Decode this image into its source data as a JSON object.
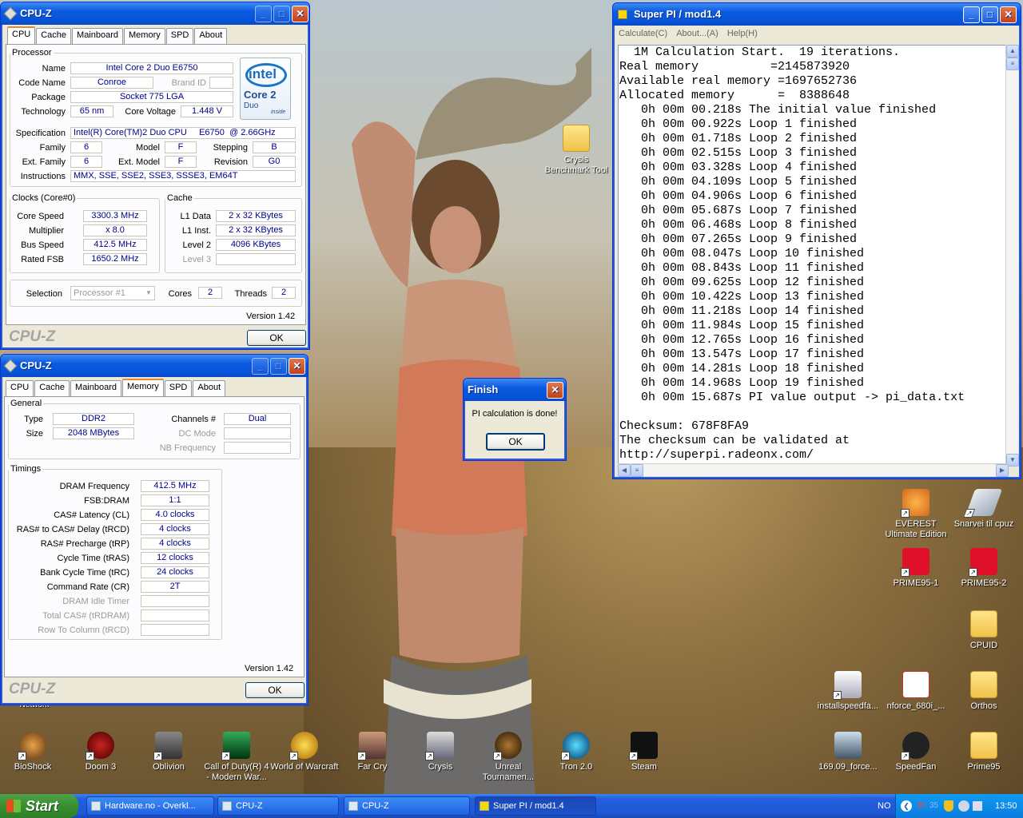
{
  "desktop": {
    "icons_right": [
      {
        "label": "Crysis Benchmark Tool"
      },
      {
        "label": "EVEREST Ultimate Edition"
      },
      {
        "label": "Snarvei til cpuz"
      },
      {
        "label": "PRIME95-1"
      },
      {
        "label": "PRIME95-2"
      },
      {
        "label": "CPUID"
      },
      {
        "label": "installspeedfa..."
      },
      {
        "label": "nforce_680i_..."
      },
      {
        "label": "Orthos"
      },
      {
        "label": "169.09_force..."
      },
      {
        "label": "SpeedFan"
      },
      {
        "label": "Prime95"
      }
    ],
    "icons_bottom": [
      "BioShock",
      "Doom 3",
      "Oblivion",
      "Call of Duty(R) 4 - Modern War...",
      "World of Warcraft",
      "Far Cry",
      "Crysis",
      "Unreal Tournamen...",
      "Tron 2.0",
      "Steam"
    ],
    "partial_label": "Network"
  },
  "cpuz1": {
    "title": "CPU-Z",
    "tabs": [
      "CPU",
      "Cache",
      "Mainboard",
      "Memory",
      "SPD",
      "About"
    ],
    "active": "CPU",
    "processor_legend": "Processor",
    "name_lbl": "Name",
    "name": "Intel Core 2 Duo E6750",
    "codename_lbl": "Code Name",
    "codename": "Conroe",
    "brandid_lbl": "Brand ID",
    "package_lbl": "Package",
    "package": "Socket 775 LGA",
    "tech_lbl": "Technology",
    "tech": "65 nm",
    "voltage_lbl": "Core Voltage",
    "voltage": "1.448 V",
    "spec_lbl": "Specification",
    "spec": "Intel(R) Core(TM)2 Duo CPU     E6750  @ 2.66GHz",
    "family_lbl": "Family",
    "family": "6",
    "model_lbl": "Model",
    "model": "F",
    "stepping_lbl": "Stepping",
    "stepping": "B",
    "extfamily_lbl": "Ext. Family",
    "extfamily": "6",
    "extmodel_lbl": "Ext. Model",
    "extmodel": "F",
    "revision_lbl": "Revision",
    "revision": "G0",
    "instr_lbl": "Instructions",
    "instr": "MMX, SSE, SSE2, SSE3, SSSE3, EM64T",
    "logo": {
      "brand": "intel",
      "line1": "Core 2",
      "line2": "Duo",
      "tag": "inside"
    },
    "clocks_legend": "Clocks (Core#0)",
    "corespeed_lbl": "Core Speed",
    "corespeed": "3300.3 MHz",
    "mult_lbl": "Multiplier",
    "mult": "x 8.0",
    "bus_lbl": "Bus Speed",
    "bus": "412.5 MHz",
    "fsb_lbl": "Rated FSB",
    "fsb": "1650.2 MHz",
    "cache_legend": "Cache",
    "l1d_lbl": "L1 Data",
    "l1d": "2 x 32 KBytes",
    "l1i_lbl": "L1 Inst.",
    "l1i": "2 x 32 KBytes",
    "l2_lbl": "Level 2",
    "l2": "4096 KBytes",
    "l3_lbl": "Level 3",
    "sel_lbl": "Selection",
    "sel": "Processor #1",
    "cores_lbl": "Cores",
    "cores": "2",
    "threads_lbl": "Threads",
    "threads": "2",
    "version": "Version 1.42",
    "brandmark": "CPU-Z",
    "ok": "OK"
  },
  "cpuz2": {
    "title": "CPU-Z",
    "tabs": [
      "CPU",
      "Cache",
      "Mainboard",
      "Memory",
      "SPD",
      "About"
    ],
    "active": "Memory",
    "general_legend": "General",
    "type_lbl": "Type",
    "type": "DDR2",
    "size_lbl": "Size",
    "size": "2048 MBytes",
    "channels_lbl": "Channels #",
    "channels": "Dual",
    "dcmode_lbl": "DC Mode",
    "nbfreq_lbl": "NB Frequency",
    "timings_legend": "Timings",
    "rows": [
      {
        "lbl": "DRAM Frequency",
        "val": "412.5 MHz"
      },
      {
        "lbl": "FSB:DRAM",
        "val": "1:1"
      },
      {
        "lbl": "CAS# Latency (CL)",
        "val": "4.0 clocks"
      },
      {
        "lbl": "RAS# to CAS# Delay (tRCD)",
        "val": "4 clocks"
      },
      {
        "lbl": "RAS# Precharge (tRP)",
        "val": "4 clocks"
      },
      {
        "lbl": "Cycle Time (tRAS)",
        "val": "12 clocks"
      },
      {
        "lbl": "Bank Cycle Time (tRC)",
        "val": "24 clocks"
      },
      {
        "lbl": "Command Rate (CR)",
        "val": "2T"
      },
      {
        "lbl": "DRAM Idle Timer",
        "val": ""
      },
      {
        "lbl": "Total CAS# (tRDRAM)",
        "val": ""
      },
      {
        "lbl": "Row To Column (tRCD)",
        "val": ""
      }
    ],
    "version": "Version 1.42",
    "brandmark": "CPU-Z",
    "ok": "OK"
  },
  "superpi": {
    "title": "Super PI / mod1.4",
    "menu": [
      "Calculate(C)",
      "About...(A)",
      "Help(H)"
    ],
    "lines": [
      "  1M Calculation Start.  19 iterations.",
      "Real memory          =2145873920",
      "Available real memory =1697652736",
      "Allocated memory      =  8388648",
      "   0h 00m 00.218s The initial value finished",
      "   0h 00m 00.922s Loop 1 finished",
      "   0h 00m 01.718s Loop 2 finished",
      "   0h 00m 02.515s Loop 3 finished",
      "   0h 00m 03.328s Loop 4 finished",
      "   0h 00m 04.109s Loop 5 finished",
      "   0h 00m 04.906s Loop 6 finished",
      "   0h 00m 05.687s Loop 7 finished",
      "   0h 00m 06.468s Loop 8 finished",
      "   0h 00m 07.265s Loop 9 finished",
      "   0h 00m 08.047s Loop 10 finished",
      "   0h 00m 08.843s Loop 11 finished",
      "   0h 00m 09.625s Loop 12 finished",
      "   0h 00m 10.422s Loop 13 finished",
      "   0h 00m 11.218s Loop 14 finished",
      "   0h 00m 11.984s Loop 15 finished",
      "   0h 00m 12.765s Loop 16 finished",
      "   0h 00m 13.547s Loop 17 finished",
      "   0h 00m 14.281s Loop 18 finished",
      "   0h 00m 14.968s Loop 19 finished",
      "   0h 00m 15.687s PI value output -> pi_data.txt",
      "",
      "Checksum: 678F8FA9",
      "The checksum can be validated at",
      "http://superpi.radeonx.com/"
    ]
  },
  "dialog": {
    "title": "Finish",
    "message": "PI calculation is done!",
    "ok": "OK"
  },
  "taskbar": {
    "start": "Start",
    "tasks": [
      {
        "label": "Hardware.no - Overkl..."
      },
      {
        "label": "CPU-Z"
      },
      {
        "label": "CPU-Z"
      },
      {
        "label": "Super PI / mod1.4"
      }
    ],
    "lang": "NO",
    "tray_nums": [
      "36",
      "35"
    ],
    "clock": "13:50"
  }
}
